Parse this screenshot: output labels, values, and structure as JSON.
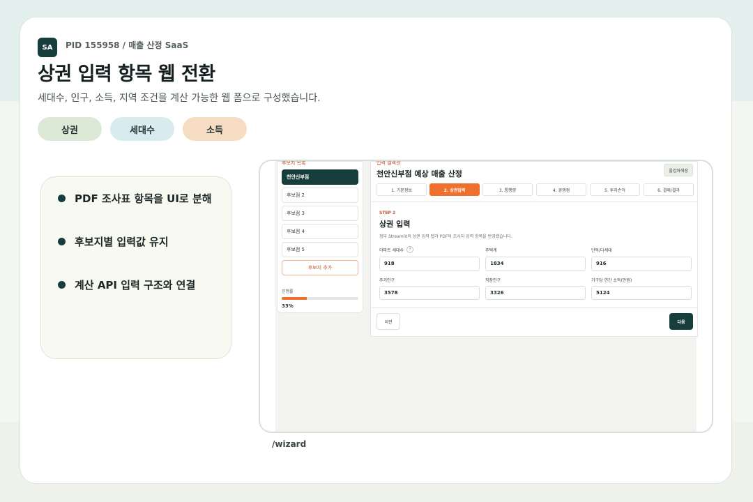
{
  "header": {
    "logo_text": "SA",
    "pid": "PID 155958 / 매출 산정 SaaS",
    "title": "상권 입력 항목 웹 전환",
    "subtitle": "세대수, 인구, 소득, 지역 조건을 계산 가능한 웹 폼으로 구성했습니다."
  },
  "chips": [
    "상권",
    "세대수",
    "소득"
  ],
  "bullets": [
    "PDF 조사표 항목을 UI로 분해",
    "후보지별 입력값 유지",
    "계산 API 입력 구조와 연결"
  ],
  "screenshot": {
    "sidebar": {
      "heading": "후보지 목록",
      "items": [
        "천안신부점",
        "후보점 2",
        "후보점 3",
        "후보점 4",
        "후보점 5"
      ],
      "add_label": "후보지 추가",
      "progress_label": "진행률",
      "progress_value": "33%",
      "progress_fraction": 0.33
    },
    "main": {
      "top_label": "입력 셀렉션",
      "title": "천안신부점 예상 매출 산정",
      "action_label": "올업마해장",
      "steps": [
        "1. 기본정보",
        "2. 상권입력",
        "3. 통행량",
        "4. 경쟁점",
        "5. 투자손익",
        "6. 결제/결과"
      ],
      "step_tag": "STEP 2",
      "section_title": "상권 입력",
      "section_desc": "정부 Streamlit의 상권 입력 탭과 PDF의 조사지 입력 항목을 반영했습니다.",
      "fields": [
        {
          "label": "아파트 세대수",
          "value": "918"
        },
        {
          "label": "주택계",
          "value": "1834"
        },
        {
          "label": "단독/다세대",
          "value": "916"
        },
        {
          "label": "주거인구",
          "value": "3578"
        },
        {
          "label": "직장인구",
          "value": "3326"
        },
        {
          "label": "가구당 연간 소득(만원)",
          "value": "5124"
        }
      ],
      "help_symbol": "?",
      "prev_label": "이전",
      "next_label": "다음"
    }
  },
  "route": "/wizard",
  "colors": {
    "accent": "#ef6f2d",
    "brand": "#173d3c"
  }
}
